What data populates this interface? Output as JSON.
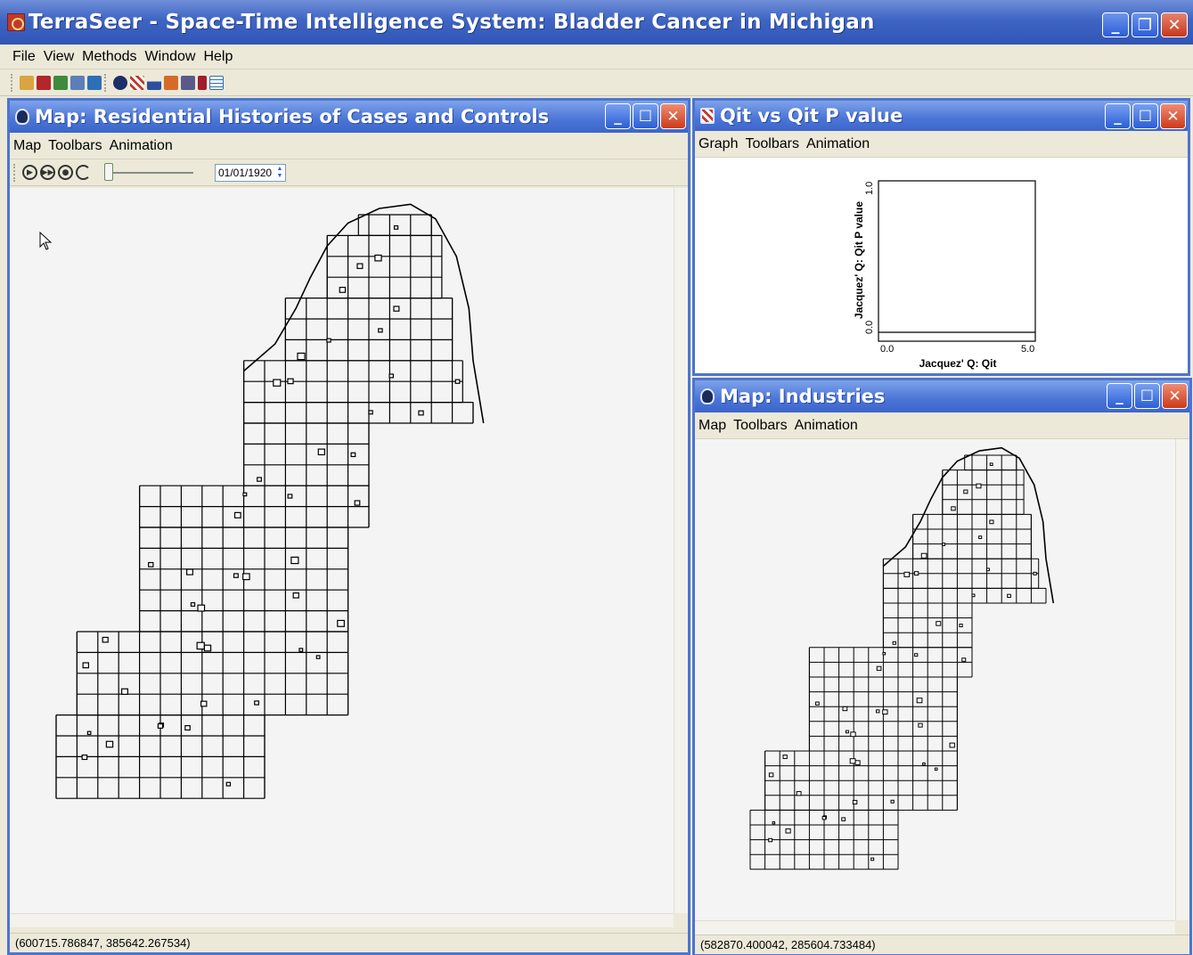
{
  "app": {
    "title": "TerraSeer - Space-Time Intelligence System: Bladder Cancer in Michigan",
    "menu": [
      "File",
      "View",
      "Methods",
      "Window",
      "Help"
    ]
  },
  "windows": {
    "map1": {
      "title": "Map: Residential Histories of Cases and Controls",
      "menu": [
        "Map",
        "Toolbars",
        "Animation"
      ],
      "date": "01/01/1920",
      "status": "(600715.786847, 385642.267534)"
    },
    "graph": {
      "title": "Qit vs Qit P value",
      "menu": [
        "Graph",
        "Toolbars",
        "Animation"
      ],
      "xlabel": "Jacquez' Q: Qit",
      "ylabel": "Jacquez' Q: Qit P value",
      "x_min_label": "0.0",
      "x_max_label": "5.0",
      "y_min_label": "0.0",
      "y_max_label": "1.0"
    },
    "map2": {
      "title": "Map: Industries",
      "menu": [
        "Map",
        "Toolbars",
        "Animation"
      ],
      "status": "(582870.400042, 285604.733484)"
    }
  },
  "chart_data": {
    "type": "scatter",
    "title": "Qit vs Qit P value",
    "xlabel": "Jacquez' Q: Qit",
    "ylabel": "Jacquez' Q: Qit P value",
    "xlim": [
      0.0,
      5.0
    ],
    "ylim": [
      0.0,
      1.0
    ],
    "series": []
  },
  "colors": {
    "titlebar": "#3e64c4",
    "close_button": "#c6381b",
    "window_bg": "#ece9d8",
    "map_bg": "#f4f4f4"
  }
}
